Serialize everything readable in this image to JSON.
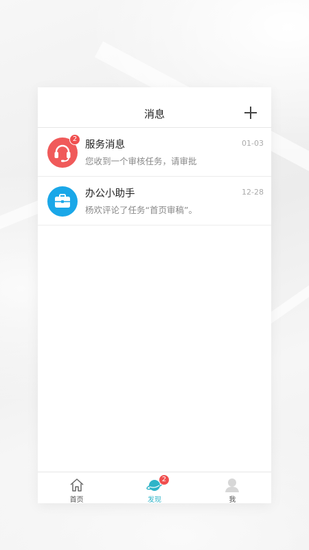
{
  "header": {
    "title": "消息",
    "add_icon": "plus-icon"
  },
  "messages": [
    {
      "name": "服务消息",
      "preview": "您收到一个审核任务，请审批",
      "time": "01-03",
      "badge": "2",
      "icon": "headset-icon",
      "color": "#f05a5a"
    },
    {
      "name": "办公小助手",
      "preview": "杨欢评论了任务“首页审稿”。",
      "time": "12-28",
      "badge": "",
      "icon": "briefcase-icon",
      "color": "#1aa7e8"
    }
  ],
  "tabbar": {
    "tabs": [
      {
        "label": "首页",
        "icon": "home-icon",
        "active": false
      },
      {
        "label": "发现",
        "icon": "planet-icon",
        "active": true,
        "badge": "2"
      },
      {
        "label": "我",
        "icon": "user-icon",
        "active": false
      }
    ]
  },
  "colors": {
    "accent": "#2fb4c8",
    "badge": "#f04f4f"
  }
}
